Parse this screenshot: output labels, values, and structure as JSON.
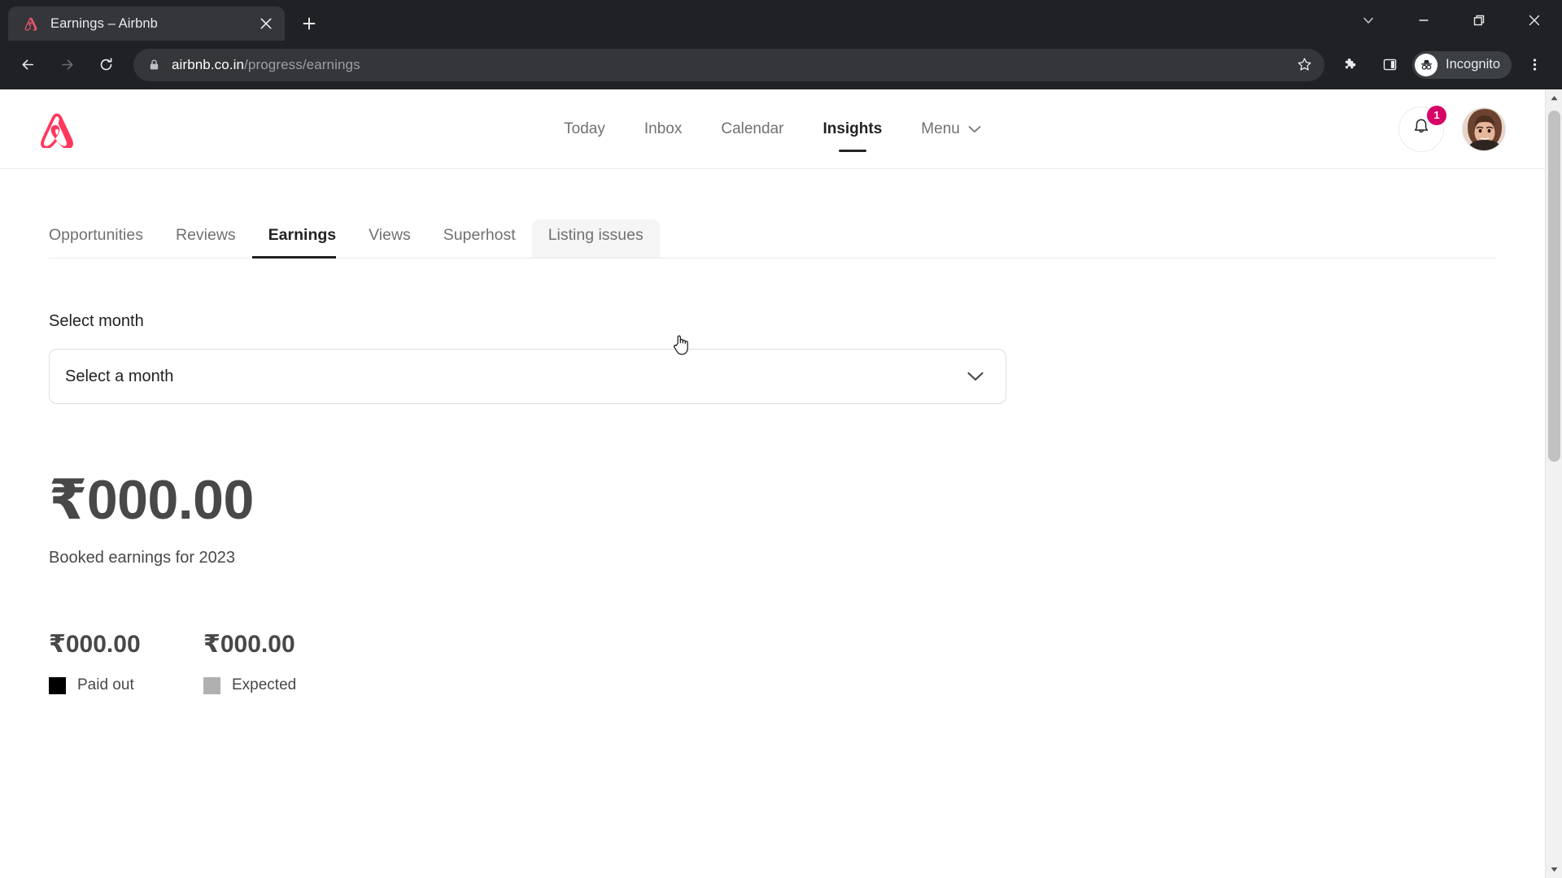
{
  "browser": {
    "tab": {
      "title": "Earnings – Airbnb",
      "favicon_icon": "airbnb-belo-icon",
      "close_icon": "close-icon"
    },
    "new_tab_icon": "plus-icon",
    "window_controls": [
      {
        "name": "chevron-down-icon",
        "label": "Search tabs"
      },
      {
        "name": "minimize-icon",
        "label": "Minimize"
      },
      {
        "name": "restore-icon",
        "label": "Restore"
      },
      {
        "name": "close-window-icon",
        "label": "Close"
      }
    ],
    "toolbar": {
      "back_icon": "back-arrow-icon",
      "forward_icon": "forward-arrow-icon",
      "reload_icon": "reload-icon",
      "lock_icon": "lock-icon",
      "url_host": "airbnb.co.in",
      "url_path": "/progress/earnings",
      "bookmark_icon": "star-icon",
      "extensions_icon": "puzzle-piece-icon",
      "sidepanel_icon": "side-panel-icon",
      "incognito_label": "Incognito",
      "incognito_icon": "incognito-hat-icon",
      "menu_icon": "three-dot-menu-icon"
    }
  },
  "site": {
    "logo_icon": "airbnb-belo-logo",
    "nav": [
      {
        "label": "Today",
        "active": false
      },
      {
        "label": "Inbox",
        "active": false
      },
      {
        "label": "Calendar",
        "active": false
      },
      {
        "label": "Insights",
        "active": true
      },
      {
        "label": "Menu",
        "active": false,
        "chevron": true
      }
    ],
    "notifications": {
      "icon": "bell-icon",
      "badge": "1"
    },
    "avatar_icon": "user-avatar"
  },
  "tabs": [
    {
      "label": "Opportunities",
      "state": "default"
    },
    {
      "label": "Reviews",
      "state": "default"
    },
    {
      "label": "Earnings",
      "state": "active"
    },
    {
      "label": "Views",
      "state": "default"
    },
    {
      "label": "Superhost",
      "state": "default"
    },
    {
      "label": "Listing issues",
      "state": "hover"
    }
  ],
  "main": {
    "select_month_label": "Select month",
    "select_month_value": "Select a month",
    "select_chevron_icon": "chevron-down-icon",
    "booked_amount": "₹000.00",
    "booked_caption": "Booked earnings for 2023",
    "breakdown": [
      {
        "amount": "₹000.00",
        "label": "Paid out",
        "color": "#000000"
      },
      {
        "amount": "₹000.00",
        "label": "Expected",
        "color": "#b0b0b0"
      }
    ]
  },
  "scrollbar": {
    "up_icon": "scroll-up-arrow-icon",
    "down_icon": "scroll-down-arrow-icon"
  },
  "colors": {
    "brand": "#FF385C",
    "badge": "#D70466",
    "text_primary": "#222222",
    "text_secondary": "#717171",
    "amount_text": "#484848"
  }
}
